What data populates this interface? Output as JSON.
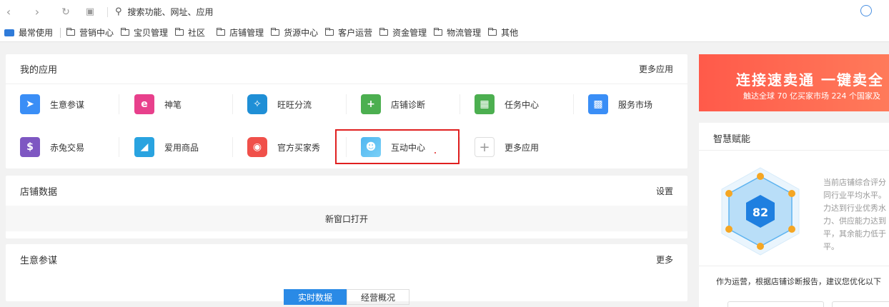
{
  "browser": {
    "search_placeholder": "搜索功能、网址、应用"
  },
  "bookmarks": {
    "items": [
      "最常使用",
      "营销中心",
      "宝贝管理",
      "社区",
      "店铺管理",
      "货源中心",
      "客户运营",
      "资金管理",
      "物流管理",
      "其他"
    ]
  },
  "my_apps": {
    "title": "我的应用",
    "more_link": "更多应用",
    "apps": [
      {
        "label": "生意参谋",
        "icon": "compass-icon",
        "color": "#3a8ef6"
      },
      {
        "label": "神笔",
        "icon": "pen-icon",
        "color": "#e8408c"
      },
      {
        "label": "旺旺分流",
        "icon": "wangwang-icon",
        "color": "#1f8fd6"
      },
      {
        "label": "店铺诊断",
        "icon": "medkit-icon",
        "color": "#4caf50"
      },
      {
        "label": "任务中心",
        "icon": "calendar-icon",
        "color": "#4caf50"
      },
      {
        "label": "服务市场",
        "icon": "bag-icon",
        "color": "#3a8ef6"
      },
      {
        "label": "赤兔交易",
        "icon": "money-bag-icon",
        "color": "#7e57c2"
      },
      {
        "label": "爱用商品",
        "icon": "boot-icon",
        "color": "#29a3e0"
      },
      {
        "label": "官方买家秀",
        "icon": "show-icon",
        "color": "#f0504a"
      },
      {
        "label": "互动中心",
        "icon": "people-icon",
        "color": "#4fb6f0"
      },
      {
        "label": "更多应用",
        "icon": "plus-icon",
        "color": "#ffffff"
      }
    ]
  },
  "shop_data": {
    "title": "店铺数据",
    "settings_link": "设置",
    "new_window": "新窗口打开"
  },
  "biz_advisor": {
    "title": "生意参谋",
    "more_link": "更多",
    "tabs": [
      "实时数据",
      "经营概况"
    ]
  },
  "right_panel": {
    "banner_title": "连接速卖通 一键卖全",
    "banner_sub": "触达全球 70 亿买家市场 224 个国家及",
    "smart_title": "智慧赋能",
    "score": "82",
    "desc_lines": [
      "当前店铺综合评分",
      "同行业平均水平。",
      "力达到行业优秀水",
      "力、供应能力达到",
      "平，其余能力低于",
      "平。"
    ],
    "suggestion": "作为运营，根据店铺诊断报告，建议您优化以下"
  },
  "colors": {
    "accent": "#2a8ae6",
    "highlight_box": "#e02020",
    "banner": "#ff5a4a"
  }
}
